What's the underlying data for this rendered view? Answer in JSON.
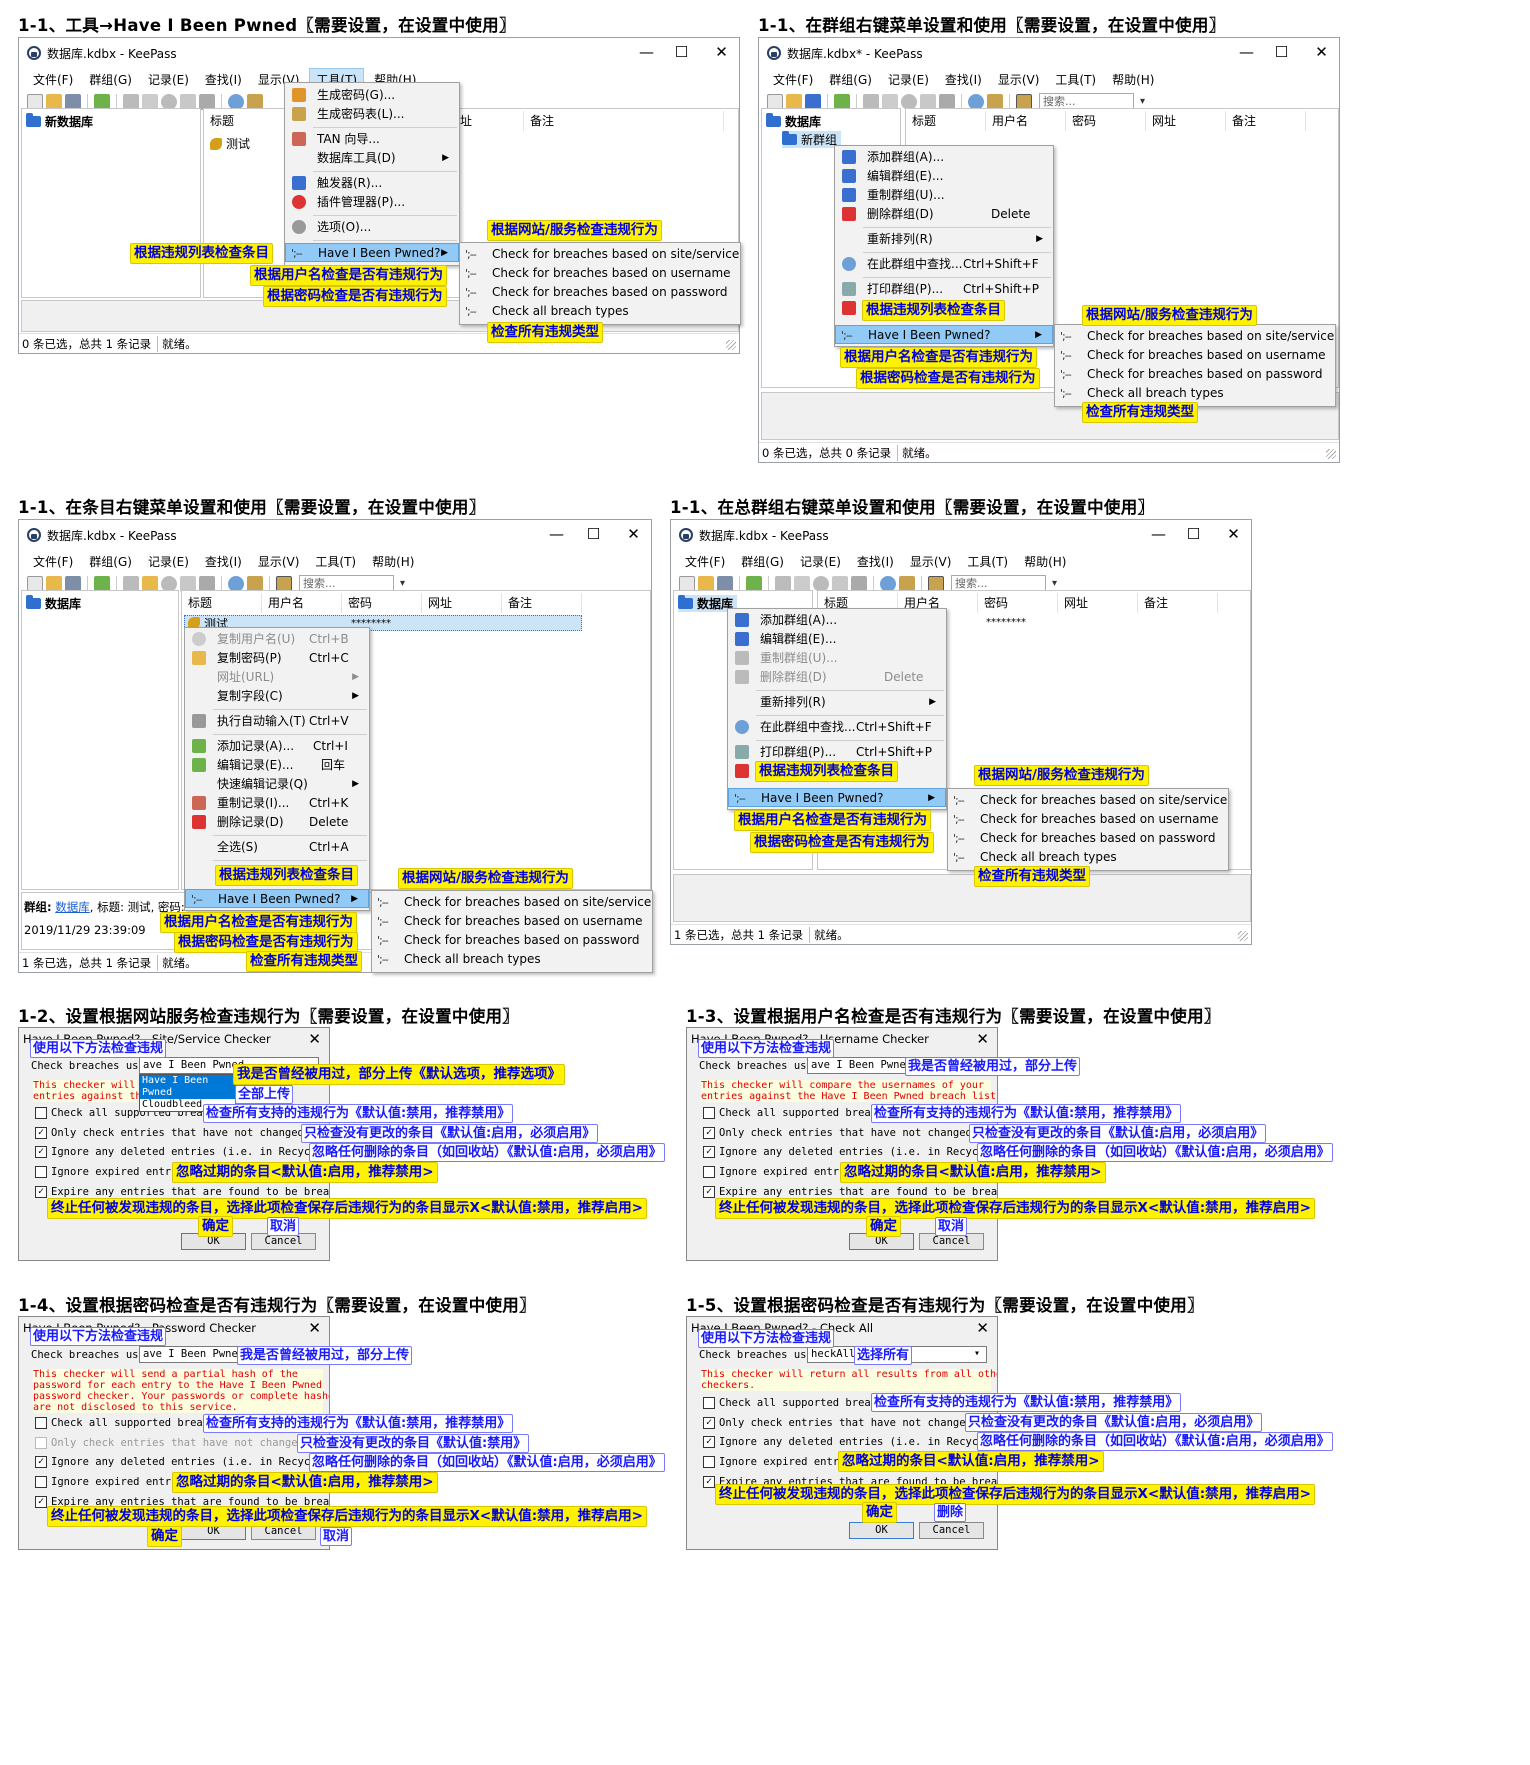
{
  "sections": {
    "s1": "1-1、工具→Have I Been Pwned〖需要设置，在设置中使用〗",
    "s2": "1-1、在群组右键菜单设置和使用〖需要设置，在设置中使用〗",
    "s3": "1-1、在条目右键菜单设置和使用〖需要设置，在设置中使用〗",
    "s4": "1-1、在总群组右键菜单设置和使用〖需要设置，在设置中使用〗",
    "s5": "1-2、设置根据网站服务检查违规行为〖需要设置，在设置中使用〗",
    "s6": "1-3、设置根据用户名检查是否有违规行为〖需要设置，在设置中使用〗",
    "s7": "1-4、设置根据密码检查是否有违规行为〖需要设置，在设置中使用〗",
    "s8": "1-5、设置根据密码检查是否有违规行为〖需要设置，在设置中使用〗"
  },
  "window": {
    "title1": "数据库.kdbx - KeePass",
    "title2": "数据库.kdbx* - KeePass",
    "minimize": "—",
    "maximize": "☐",
    "close": "✕",
    "menubar": [
      "文件(F)",
      "群组(G)",
      "记录(E)",
      "查找(I)",
      "显示(V)",
      "工具(T)",
      "帮助(H)"
    ],
    "search": "搜索...",
    "cols": [
      "标题",
      "用户名",
      "密码",
      "网址",
      "备注"
    ],
    "col_note": "备注",
    "col_url": "址",
    "root_new": "新数据库",
    "root": "数据库",
    "new_group": "新群组",
    "entry": "测试",
    "pw_mask": "********",
    "status_a": [
      "0 条已选，总共 1 条记录",
      "就绪。"
    ],
    "status_b": [
      "0 条已选，总共 0 条记录",
      "就绪。"
    ],
    "status_c": [
      "1 条已选，总共 1 条记录",
      "就绪。"
    ],
    "details": {
      "group_label": "群组:",
      "group": "数据库",
      "title_part": ", 标题: 测试, 密码: ***",
      "time": "2019/11/29 23:39:09"
    }
  },
  "tools_menu": [
    "生成密码(G)...",
    "生成密码表(L)...",
    "TAN 向导...",
    "数据库工具(D)",
    "触发器(R)...",
    "插件管理器(P)...",
    "选项(O)...",
    "Have I Been Pwned?"
  ],
  "group_menu": {
    "items": [
      "添加群组(A)...",
      "编辑群组(E)...",
      "重制群组(U)...",
      "删除群组(D)",
      "重新排列(R)",
      "在此群组中查找...",
      "打印群组(P)...",
      "Have I Been Pwned?"
    ],
    "shortcuts": [
      "Delete",
      "Ctrl+Shift+F",
      "Ctrl+Shift+P"
    ]
  },
  "entry_menu": {
    "items": [
      "复制用户名(U)",
      "复制密码(P)",
      "网址(URL)",
      "复制字段(C)",
      "执行自动输入(T)",
      "添加记录(A)...",
      "编辑记录(E)...",
      "快速编辑记录(Q)",
      "重制记录(I)...",
      "删除记录(D)",
      "全选(S)",
      "Have I Been Pwned?"
    ],
    "shortcuts": [
      "Ctrl+B",
      "Ctrl+C",
      "Ctrl+V",
      "Ctrl+I",
      "回车",
      "Ctrl+K",
      "Delete",
      "Ctrl+A"
    ]
  },
  "sub": {
    "prefix": "';--",
    "items": [
      "Check for breaches based on site/service",
      "Check for breaches based on username",
      "Check for breaches based on password",
      "Check all breach types"
    ]
  },
  "ann": {
    "site": "根据网站/服务检查违规行为",
    "list": "根据违规列表检查条目",
    "user": "根据用户名检查是否有违规行为",
    "pass": "根据密码检查是否有违规行为",
    "all": "检查所有违规类型",
    "method": "使用以下方法检查违规",
    "partial_def": "我是否曾经被用过，部分上传《默认选项，推荐选项》",
    "partial": "我是否曾经被用过，部分上传",
    "all_up": "全部上传",
    "select_all": "选择所有",
    "check_all": "检查所有支持的违规行为《默认值:禁用，推荐禁用》",
    "only_changed": "只检查没有更改的条目《默认值:启用，必须启用》",
    "only_changed_dis": "只检查没有更改的条目《默认值:禁用》",
    "ignore_del": "忽略任何删除的条目（如回收站）《默认值:启用，必须启用》",
    "ignore_exp": "忽略过期的条目<默认值:启用，推荐禁用>",
    "expire": "终止任何被发现违规的条目，选择此项检查保存后违规行为的条目显示X<默认值:禁用，推荐启用>",
    "ok": "确定",
    "cancel": "取消",
    "delete": "删除"
  },
  "dlg": {
    "t_site": "Have I Been Pwned? - Site/Service Checker",
    "t_user": "Have I Been Pwned? - Username Checker",
    "t_pass": "Have I Been Pwned? - Password Checker",
    "t_all": "Have I Been Pwned? - Check All",
    "close": "✕",
    "check_using": "Check breaches using:",
    "opt_hibp": "Have I Been Pwned",
    "opt_hibp_cut": "ave I Been Pwned",
    "opt_cloud": "Cloudbleed",
    "opt_checkall": "heckAll",
    "warn_site": "This checker will c\nentries against the",
    "warn_user": "This checker will compare the usernames of your\nentries against the Have I Been Pwned breach list",
    "warn_pass": "This checker will send a partial hash of the\npassword for each entry to the Have I Been Pwned\npassword checker. Your passwords or complete hashes\nare not disclosed to this service.",
    "warn_all": "This checker will return all results from all other\ncheckers.",
    "opt1": "Check all supported breaches",
    "opt2": "Only check entries that have not changed since",
    "opt3": "Ignore any deleted entries (i.e. in Recycle Bin)",
    "opt4": "Ignore expired entries",
    "opt5": "Expire any entries that are found to be breached",
    "ok": "OK",
    "cancel": "Cancel",
    "check": "✓"
  },
  "colors": {
    "highlight": "#91c9f7",
    "annotation": "#fff200",
    "annotation_text": "#0000e0",
    "warning": "#e00000"
  }
}
